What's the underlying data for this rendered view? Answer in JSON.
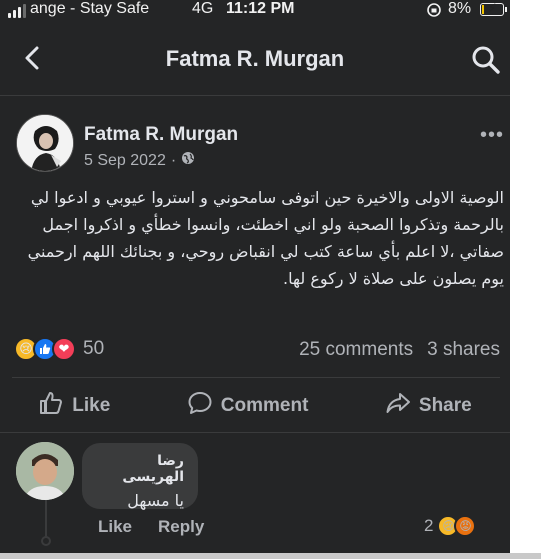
{
  "status_bar": {
    "carrier": "ange - Stay Safe",
    "network": "4G",
    "time": "11:12 PM",
    "battery_percent": "8%",
    "battery_level": 0.08,
    "battery_fill_color": "#f2c400"
  },
  "header": {
    "title": "Fatma R. Murgan",
    "back_icon": "chevron-left-icon",
    "search_icon": "search-icon"
  },
  "post": {
    "author": "Fatma R. Murgan",
    "date": "5 Sep 2022",
    "separator": "·",
    "privacy_icon": "globe-icon",
    "more_icon": "more-horizontal-icon",
    "body": "الوصية الاولى والاخيرة حين اتوفى سامحوني  و استروا عيوبي و ادعوا لي بالرحمة وتذكروا الصحبة ولو اني اخطئت، وانسوا خطأي و اذكروا اجمل صفاتي ،لا اعلم بأي ساعة كتب لي انقباض روحي، و بجنائك اللهم ارحمني يوم يصلون على صلاة لا ركوع لها.",
    "reaction_icons": [
      "sad-emoji",
      "like-emoji",
      "love-emoji"
    ],
    "reaction_count": "50",
    "comments_count": "25 comments",
    "shares_count": "3 shares"
  },
  "actions": {
    "like": "Like",
    "comment": "Comment",
    "share": "Share"
  },
  "comment": {
    "author": "رضا الهريسى",
    "text": "يا مسهل",
    "like_label": "Like",
    "reply_label": "Reply",
    "reaction_count": "2",
    "reaction_icons": [
      "sad-emoji",
      "angry-emoji"
    ]
  },
  "colors": {
    "background": "#242526",
    "text_primary": "#e4e6eb",
    "text_secondary": "#b0b3b8",
    "bubble": "#3a3b3c",
    "like_blue": "#1877f2",
    "love_red": "#f33e58",
    "sad_yellow": "#f7b928",
    "angry_orange": "#e9710f"
  }
}
